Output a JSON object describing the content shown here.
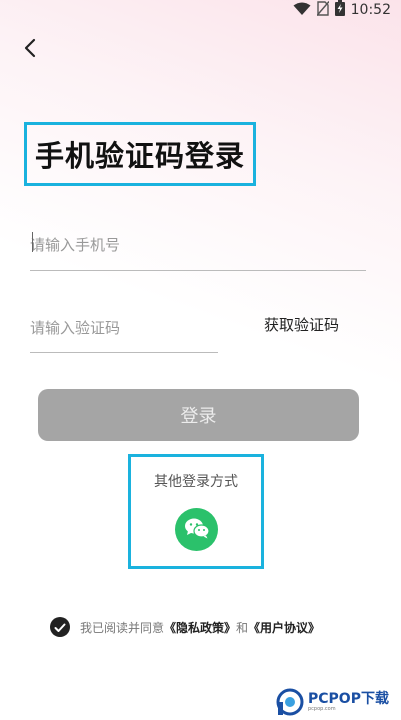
{
  "status_bar": {
    "time": "10:52",
    "icons": [
      "wifi-icon",
      "no-sim-icon",
      "battery-charging-icon"
    ]
  },
  "header": {
    "back_icon": "chevron-left-icon"
  },
  "page": {
    "title": "手机验证码登录"
  },
  "form": {
    "phone_placeholder": "请输入手机号",
    "phone_value": "",
    "code_placeholder": "请输入验证码",
    "code_value": "",
    "get_code_label": "获取验证码",
    "login_label": "登录"
  },
  "other_login": {
    "label": "其他登录方式",
    "methods": [
      {
        "name": "wechat",
        "icon": "wechat-icon",
        "color": "#2bc16b"
      }
    ]
  },
  "agreement": {
    "checked": true,
    "prefix": "我已阅读并同意",
    "privacy_link": "《隐私政策》",
    "conjunction": "和",
    "terms_link": "《用户协议》"
  },
  "watermark": {
    "brand": "PCPOP下载",
    "sub": "pcpop.com"
  },
  "colors": {
    "highlight_border": "#1ab2de",
    "login_button_disabled": "#a5a5a5",
    "wechat_green": "#2bc16b"
  }
}
